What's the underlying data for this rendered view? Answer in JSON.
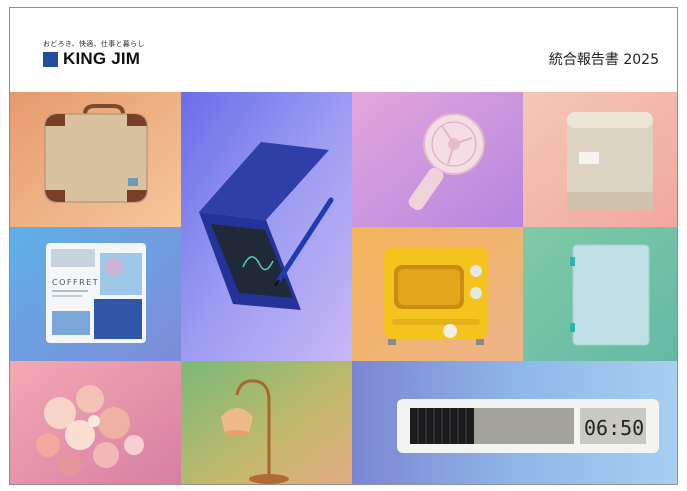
{
  "header": {
    "tagline": "おどろき、快適、仕事と暮らし",
    "logo_text": "KING JIM",
    "report_title": "統合報告書 2025"
  },
  "products": {
    "stationery_card": {
      "brand": "COFFRET"
    },
    "clock_display": {
      "time": "06:50"
    }
  },
  "colors": {
    "logo_blue": "#244d9c"
  }
}
